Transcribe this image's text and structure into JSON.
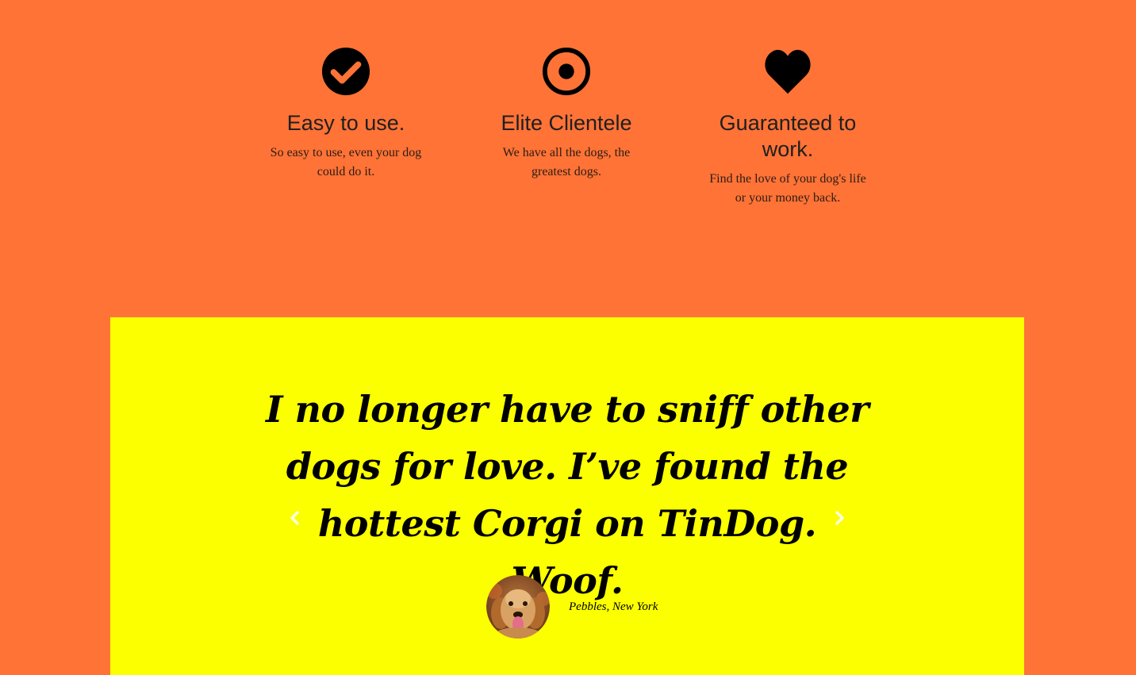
{
  "colors": {
    "page_background": "#ff7336",
    "testimonial_background": "#fbff00",
    "icon": "#000000",
    "heading_text": "#1f1f1f"
  },
  "features": [
    {
      "icon": "check-circle-icon",
      "title": "Easy to use.",
      "description": "So easy to use, even your dog could do it."
    },
    {
      "icon": "bullseye-icon",
      "title": "Elite Clientele",
      "description": "We have all the dogs, the greatest dogs."
    },
    {
      "icon": "heart-icon",
      "title": "Guaranteed to work.",
      "description": "Find the love of your dog's life or your money back."
    }
  ],
  "testimonial": {
    "quote": "I no longer have to sniff other dogs for love. I’ve found the hottest Corgi on TinDog. Woof.",
    "author": "Pebbles, New York",
    "avatar_icon": "dog-avatar",
    "prev_icon": "chevron-left-icon",
    "next_icon": "chevron-right-icon"
  }
}
